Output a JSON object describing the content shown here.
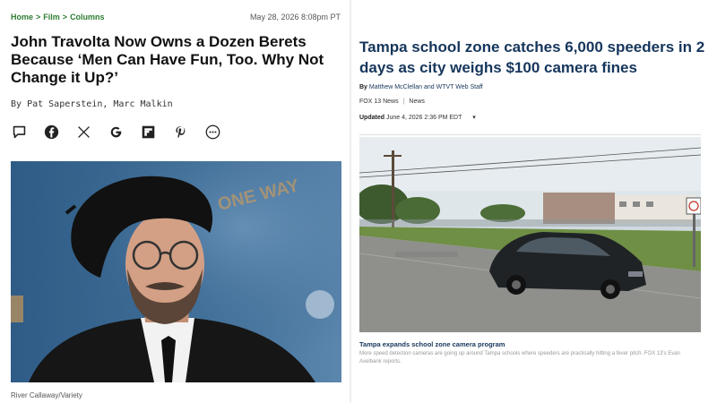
{
  "left": {
    "breadcrumb": [
      "Home",
      "Film",
      "Columns"
    ],
    "breadcrumb_sep": ">",
    "date": "May 28, 2026 8:08pm PT",
    "headline": "John Travolta Now Owns a Dozen Berets Because ‘Men Can Have Fun, Too. Why Not Change it Up?’",
    "byline_prefix": "By",
    "byline_authors": "Pat Saperstein, Marc Malkin",
    "social": [
      "comment-icon",
      "facebook-icon",
      "x-icon",
      "google-icon",
      "flipboard-icon",
      "pinterest-icon",
      "more-icon"
    ],
    "photo_backdrop_text": "ONE WAY",
    "photo_credit": "River Callaway/Variety",
    "colors": {
      "accent": "#2e7d32",
      "headline": "#111111"
    }
  },
  "right": {
    "headline": "Tampa school zone catches 6,000 speeders in 2 days as city weighs $100 camera fines",
    "byline_prefix": "By",
    "byline_authors": "Matthew McClellan and WTVT Web Staff",
    "station": "FOX 13 News",
    "section": "News",
    "updated_label": "Updated",
    "updated_time": "June 4, 2026 2:36 PM EDT",
    "updated_chevron": "▾",
    "caption_title": "Tampa expands school zone camera program",
    "caption_desc": "More speed detection cameras are going up around Tampa schools where speeders are practically hitting a fever pitch. FOX 13's Evan Axelbank reports.",
    "colors": {
      "headline": "#16365c"
    }
  }
}
